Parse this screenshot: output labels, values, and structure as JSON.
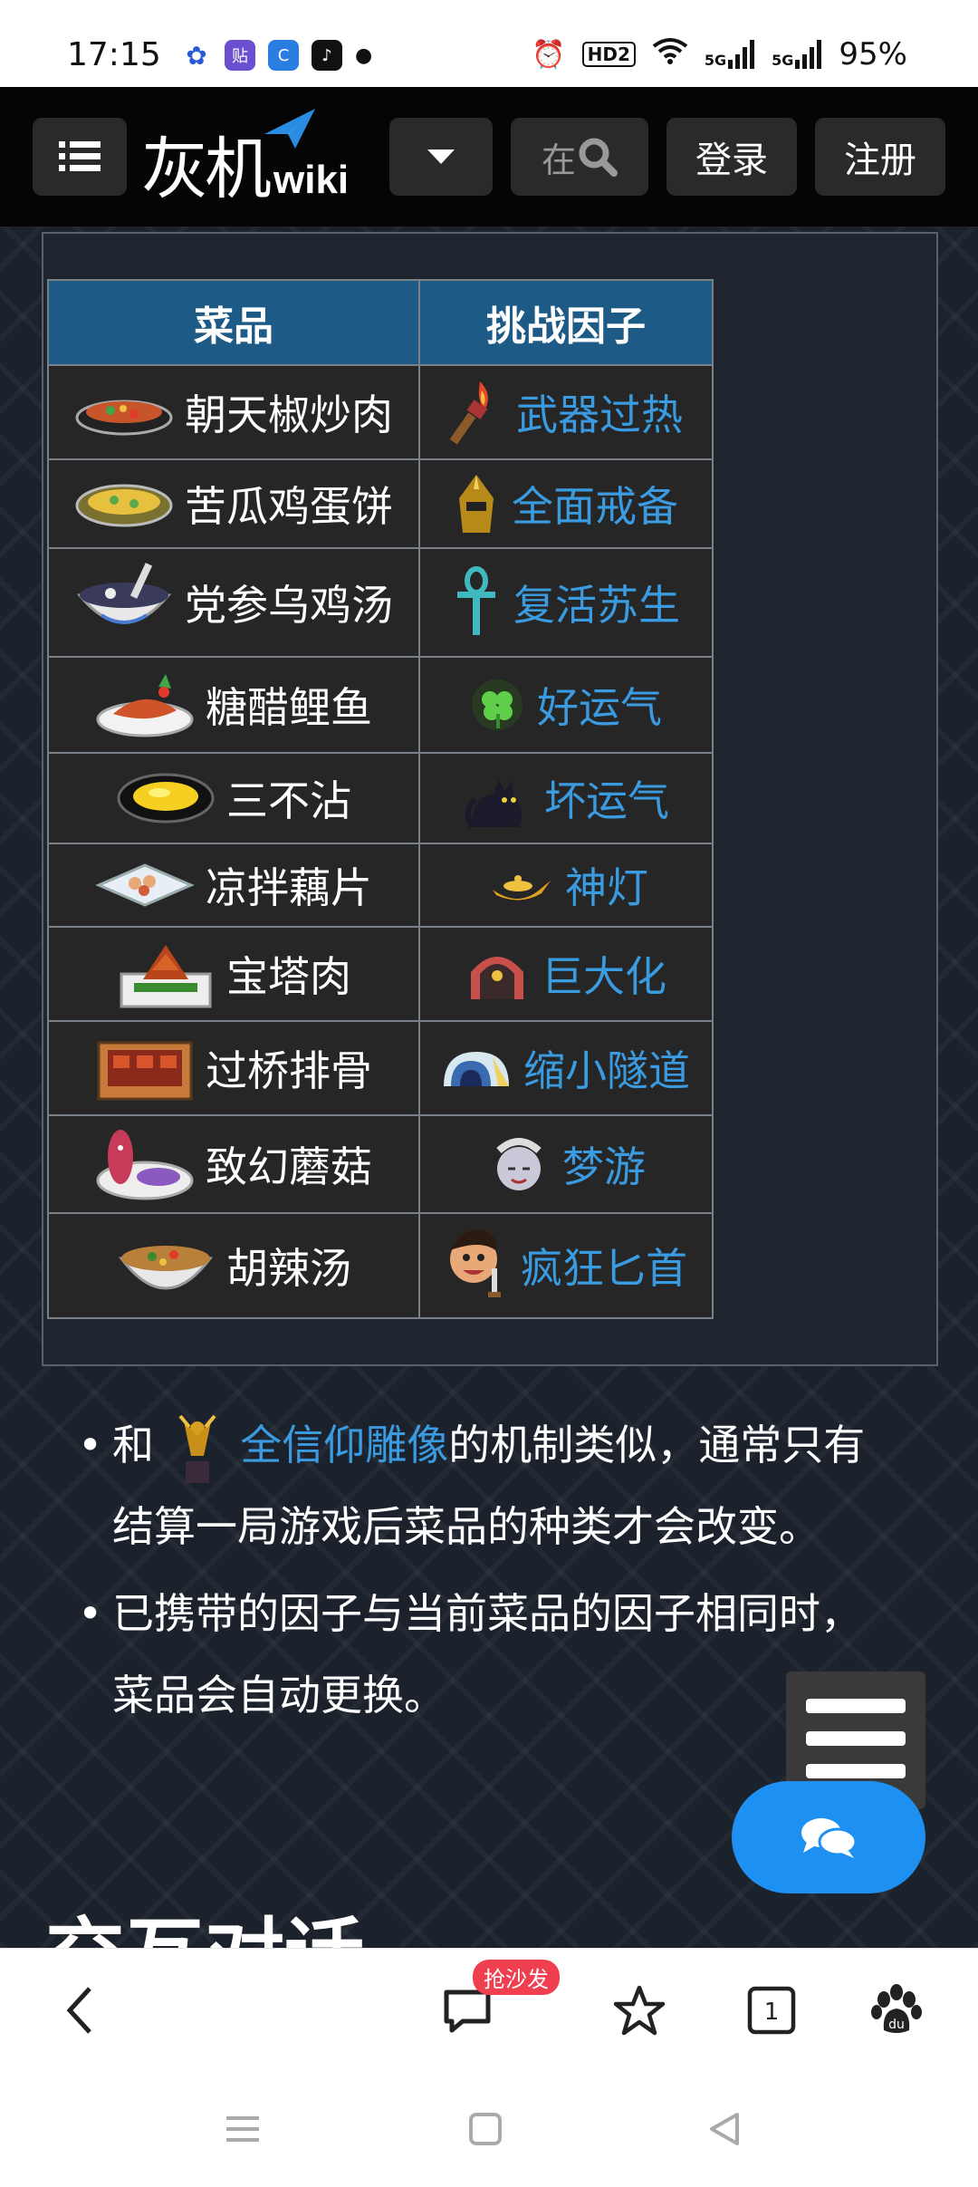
{
  "status_bar": {
    "time": "17:15",
    "battery": "95%",
    "signal_labels": [
      "HD2",
      "5G",
      "5G"
    ]
  },
  "header": {
    "logo_text": "灰机",
    "logo_suffix": "wiki",
    "search_placeholder": "在",
    "login_label": "登录",
    "register_label": "注册"
  },
  "table": {
    "headers": [
      "菜品",
      "挑战因子"
    ],
    "rows": [
      {
        "dish": "朝天椒炒肉",
        "dish_icon": "chili-pork-icon",
        "challenge": "武器过热",
        "challenge_icon": "torch-icon"
      },
      {
        "dish": "苦瓜鸡蛋饼",
        "dish_icon": "bitter-melon-pancake-icon",
        "challenge": "全面戒备",
        "challenge_icon": "helmet-icon"
      },
      {
        "dish": "党参乌鸡汤",
        "dish_icon": "chicken-soup-icon",
        "challenge": "复活苏生",
        "challenge_icon": "ankh-icon"
      },
      {
        "dish": "糖醋鲤鱼",
        "dish_icon": "sweet-sour-carp-icon",
        "challenge": "好运气",
        "challenge_icon": "clover-icon"
      },
      {
        "dish": "三不沾",
        "dish_icon": "sanbuzhan-icon",
        "challenge": "坏运气",
        "challenge_icon": "black-cat-icon"
      },
      {
        "dish": "凉拌藕片",
        "dish_icon": "lotus-root-icon",
        "challenge": "神灯",
        "challenge_icon": "magic-lamp-icon"
      },
      {
        "dish": "宝塔肉",
        "dish_icon": "pagoda-pork-icon",
        "challenge": "巨大化",
        "challenge_icon": "giant-door-icon"
      },
      {
        "dish": "过桥排骨",
        "dish_icon": "bridge-ribs-icon",
        "challenge": "缩小隧道",
        "challenge_icon": "tunnel-icon"
      },
      {
        "dish": "致幻蘑菇",
        "dish_icon": "mushroom-dish-icon",
        "challenge": "梦游",
        "challenge_icon": "sleepwalker-icon"
      },
      {
        "dish": "胡辣汤",
        "dish_icon": "hot-spicy-soup-icon",
        "challenge": "疯狂匕首",
        "challenge_icon": "crazy-dagger-icon"
      }
    ]
  },
  "bullets": {
    "b1_prefix": "和",
    "b1_link": "全信仰雕像",
    "b1_line1_rest": "的机制类似，通常只有",
    "b1_line2": "结算一局游戏后菜品的种类才会改变。",
    "b2_line1": "已携带的因子与当前菜品的因子相同时，",
    "b2_line2": "菜品会自动更换。"
  },
  "section_heading": "交互对话",
  "browser_bar": {
    "comment_badge": "抢沙发",
    "tab_count": "1"
  },
  "colors": {
    "header_bg": "#050505",
    "content_bg": "#1b222c",
    "table_header_bg": "#1d5a86",
    "link": "#3a9be0",
    "chat_button": "#1e90f2"
  }
}
